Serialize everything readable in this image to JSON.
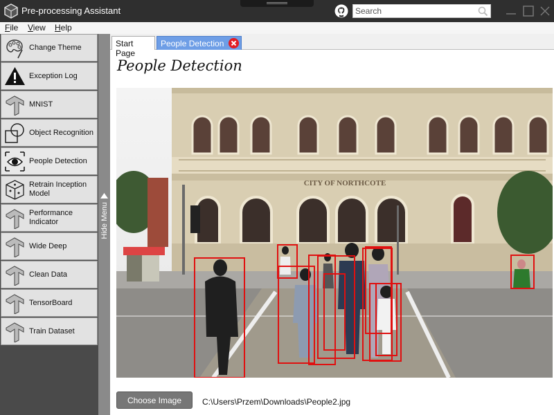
{
  "app": {
    "title": "Pre-processing Assistant"
  },
  "search": {
    "placeholder": "Search",
    "value": "Search"
  },
  "menu": {
    "items": [
      "File",
      "View",
      "Help"
    ]
  },
  "sidebar": {
    "items": [
      {
        "label": "Change Theme",
        "icon": "palette-icon"
      },
      {
        "label": "Exception Log",
        "icon": "warning-icon"
      },
      {
        "label": "MNIST",
        "icon": "tensorflow-icon"
      },
      {
        "label": "Object Recognition",
        "icon": "shapes-icon"
      },
      {
        "label": "People Detection",
        "icon": "eye-icon",
        "active": true
      },
      {
        "label": "Retrain Inception Model",
        "icon": "cube-icon"
      },
      {
        "label": "Performance Indicator",
        "icon": "tensorflow-icon"
      },
      {
        "label": "Wide Deep",
        "icon": "tensorflow-icon"
      },
      {
        "label": "Clean Data",
        "icon": "tensorflow-icon"
      },
      {
        "label": "TensorBoard",
        "icon": "tensorflow-icon"
      },
      {
        "label": "Train Dataset",
        "icon": "tensorflow-icon"
      }
    ],
    "hide_label": "Hide Menu"
  },
  "tabs": [
    {
      "label": "Start Page",
      "active": false
    },
    {
      "label": "People Detection",
      "active": true
    }
  ],
  "page": {
    "title": "People Detection",
    "building_sign": "CITY OF NORTHCOTE",
    "detections_count": 11,
    "detection_color": "#e01010"
  },
  "actions": {
    "choose_image": "Choose Image",
    "file_path": "C:\\Users\\Przem\\Downloads\\People2.jpg"
  },
  "colors": {
    "titlebar": "#2f2f2f",
    "sidebar_bg": "#4a4a4a",
    "active_tab": "#6e9ee6",
    "tab_close": "#e21d24"
  }
}
